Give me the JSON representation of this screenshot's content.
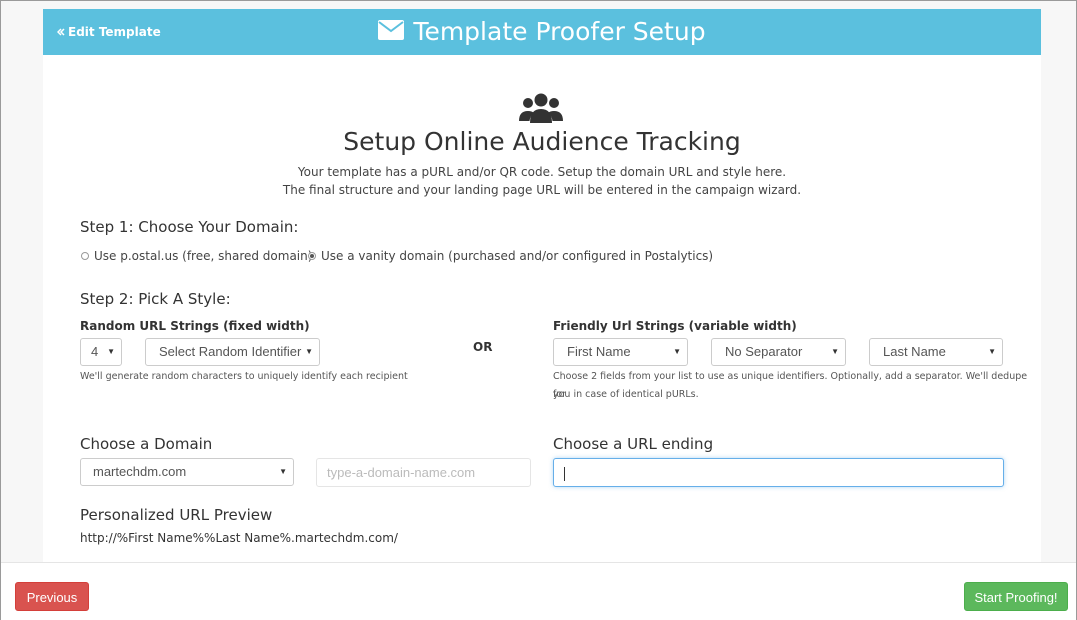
{
  "header": {
    "back_label": "Edit Template",
    "title": "Template Proofer Setup",
    "color": "#5bc0de"
  },
  "intro": {
    "title": "Setup Online Audience Tracking",
    "line1": "Your template has a pURL and/or QR code. Setup the domain URL and style here.",
    "line2": "The final structure and your landing page URL will be entered in the campaign wizard."
  },
  "step1": {
    "title": "Step 1: Choose Your Domain:",
    "option_free": "Use p.ostal.us (free, shared domain)",
    "option_vanity": "Use a vanity domain (purchased and/or configured in Postalytics)",
    "selected": "vanity"
  },
  "step2": {
    "title": "Step 2: Pick A Style:",
    "random_label": "Random URL Strings (fixed width)",
    "random_length": "4",
    "random_identifier": "Select Random Identifier",
    "random_help": "We'll generate random characters to uniquely identify each recipient",
    "or_label": "OR",
    "friendly_label": "Friendly Url Strings (variable width)",
    "field1": "First Name",
    "separator": "No Separator",
    "field2": "Last Name",
    "friendly_help_1": "Choose 2 fields from your list to use as unique identifiers. Optionally, add a separator. We'll dedupe for",
    "friendly_help_2": "you in case of identical pURLs."
  },
  "domain": {
    "label": "Choose a Domain",
    "selected": "martechdm.com",
    "placeholder": "type-a-domain-name.com"
  },
  "url_ending": {
    "label": "Choose a URL ending",
    "value": ""
  },
  "preview": {
    "label": "Personalized URL Preview",
    "url": "http://%First Name%%Last Name%.martechdm.com/"
  },
  "footer": {
    "previous_label": "Previous",
    "start_label": "Start Proofing!",
    "previous_color": "#d9534f",
    "start_color": "#5cb85c"
  },
  "icons": {
    "header_icon": "envelope-icon",
    "main_icon": "users-icon",
    "back_icon": "double-chevron-left-icon"
  }
}
